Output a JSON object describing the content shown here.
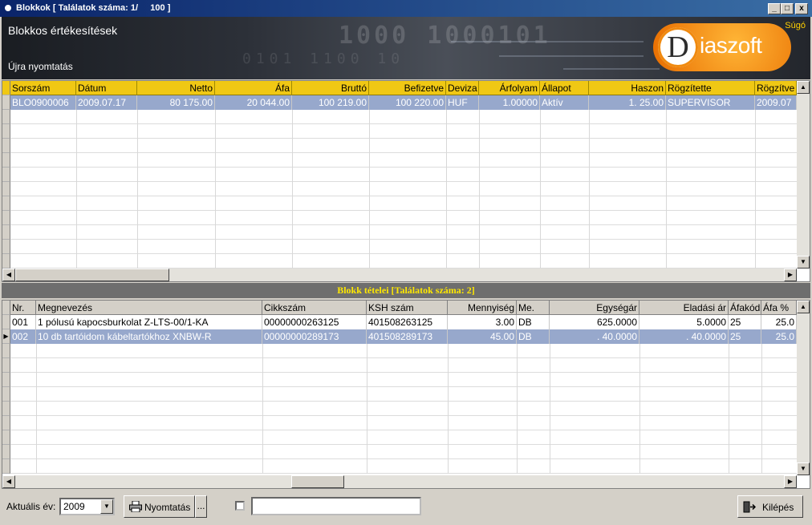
{
  "window": {
    "title": "Blokkok [ Találatok száma: 1/     100 ]",
    "btn_min": "_",
    "btn_max": "□",
    "btn_close": "x"
  },
  "banner": {
    "title": "Blokkos értékesítések",
    "reprint": "Újra nyomtatás",
    "help": "Súgó",
    "logo_letter": "D",
    "logo_text": "iaszoft"
  },
  "top_grid": {
    "columns": [
      "Sorszám",
      "Dátum",
      "Netto",
      "Áfa",
      "Bruttó",
      "Befizetve",
      "Deviza",
      "Árfolyam",
      "Állapot",
      "Haszon",
      "Rögzítette",
      "Rögzítve"
    ],
    "rows": [
      [
        "BLO0900006",
        "2009.07.17",
        "80 175.00",
        "20 044.00",
        "100 219.00",
        "100 220.00",
        "HUF",
        "1.00000",
        "Aktív",
        "1. 25.00",
        "SUPERVISOR",
        "2009.07"
      ]
    ]
  },
  "items_title": "Blokk tételei [Találatok száma: 2]",
  "bottom_grid": {
    "columns": [
      "Nr.",
      "Megnevezés",
      "Cikkszám",
      "KSH szám",
      "Mennyiség",
      "Me.",
      "Egységár",
      "Eladási ár",
      "Áfakód",
      "Áfa %"
    ],
    "rows": [
      [
        "001",
        "1 pólusú kapocsburkolat Z-LTS-00/1-KA",
        "00000000263125",
        "401508263125",
        "3.00",
        "DB",
        "625.0000",
        "5.0000",
        "25",
        "25.0"
      ],
      [
        "002",
        "10 db tartóidom kábeltartókhoz XNBW-R",
        "00000000289173",
        "401508289173",
        "45.00",
        "DB",
        ". 40.0000",
        ". 40.0000",
        "25",
        "25.0"
      ]
    ]
  },
  "footer": {
    "year_label": "Aktuális év:",
    "year_value": "2009",
    "print_label": "Nyomtatás",
    "dots_label": "...",
    "text_value": "",
    "exit_label": "Kilépés"
  },
  "colors": {
    "header_yellow": "#f0c814",
    "selected_row": "#97a8cc",
    "title_blue": "#0a246a",
    "logo_orange": "#f08a10"
  },
  "icons": [
    "window-app-icon",
    "printer-icon",
    "exit-door-icon",
    "dropdown-arrow-icon",
    "scroll-up-icon",
    "scroll-down-icon",
    "scroll-left-icon",
    "scroll-right-icon",
    "row-pointer-icon"
  ]
}
